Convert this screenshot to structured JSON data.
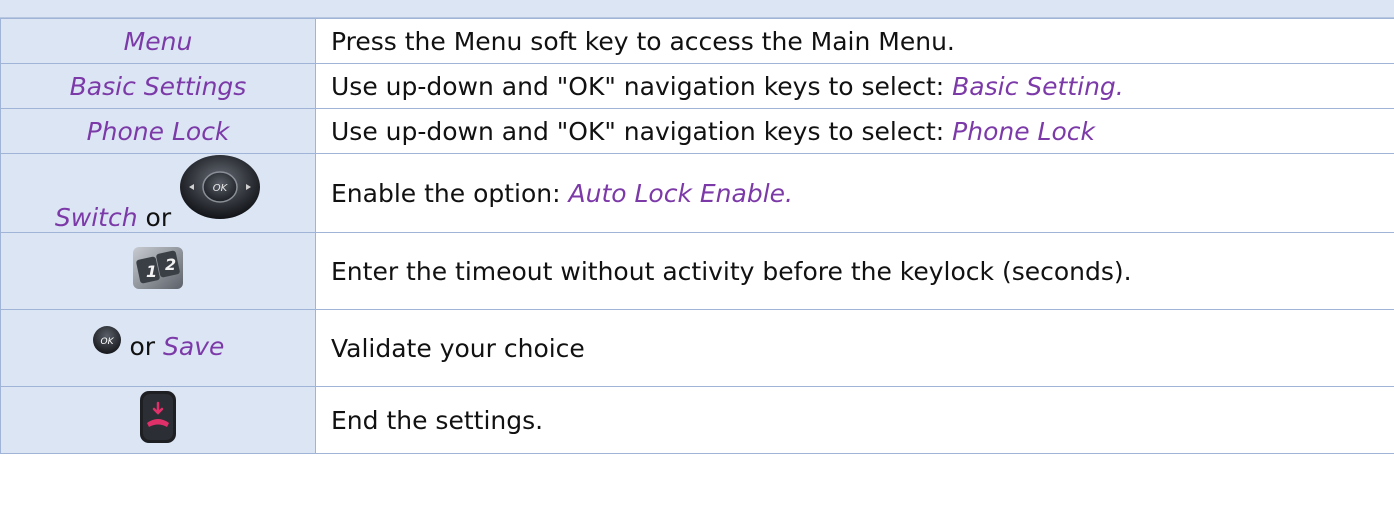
{
  "rows": [
    {
      "key": "Menu",
      "desc": "Press the Menu soft key to access the Main Menu."
    },
    {
      "key": "Basic Settings",
      "desc_prefix": "Use up-down and \"OK\" navigation keys to select: ",
      "desc_hl": "Basic Setting."
    },
    {
      "key": "Phone Lock",
      "desc_prefix": "Use up-down and \"OK\" navigation keys to select: ",
      "desc_hl": "Phone Lock"
    },
    {
      "key": "Switch",
      "key_or": "or",
      "key_icon": "navigation-pad-ok-icon",
      "desc_prefix": "Enable the option: ",
      "desc_hl": "Auto Lock Enable."
    },
    {
      "key_icon": "numeric-keypad-icon",
      "desc": "Enter the timeout without activity before the keylock (seconds)."
    },
    {
      "key_icon": "ok-key-icon",
      "key_or": "or",
      "key": "Save",
      "desc": "Validate your choice"
    },
    {
      "key_icon": "end-call-key-icon",
      "desc": "End the settings."
    }
  ],
  "icons": {
    "navpad_label": "OK",
    "ok_label": "OK",
    "keypad_digits": [
      "1",
      "2"
    ]
  },
  "colors": {
    "key_text": "#7c3aa8",
    "key_cell_bg": "#dbe5f4",
    "grid": "#9fb4d6",
    "end_call_accent": "#e0306a"
  }
}
